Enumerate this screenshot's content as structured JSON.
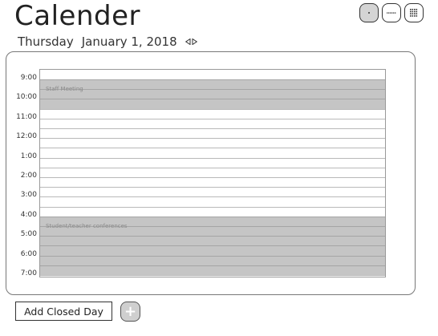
{
  "header": {
    "title": "Calender",
    "view_buttons": [
      {
        "icon": "day-view-icon",
        "selected": true
      },
      {
        "icon": "week-view-icon",
        "selected": false
      },
      {
        "icon": "month-view-icon",
        "selected": false
      }
    ]
  },
  "date_bar": {
    "weekday": "Thursday",
    "date": "January 1, 2018",
    "prev_icon": "prev-day-icon",
    "next_icon": "next-day-icon"
  },
  "schedule": {
    "hours": [
      "9:00",
      "10:00",
      "11:00",
      "12:00",
      "1:00",
      "2:00",
      "3:00",
      "4:00",
      "5:00",
      "6:00",
      "7:00"
    ],
    "events": [
      {
        "label": "Staff Meeting",
        "start": "9:00",
        "end": "10:30"
      },
      {
        "label": "Student/teacher conferences",
        "start": "4:00",
        "end": "7:00"
      }
    ]
  },
  "footer": {
    "add_closed_day_label": "Add Closed Day",
    "add_icon": "plus-icon",
    "add_symbol": "+"
  },
  "colors": {
    "event_fill": "#9a9a9a",
    "selected_view": "#d4d4d4"
  }
}
